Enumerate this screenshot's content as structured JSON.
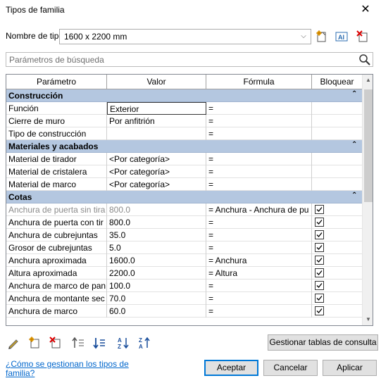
{
  "window": {
    "title": "Tipos de familia",
    "close_glyph": "✕"
  },
  "type": {
    "label": "Nombre de tipo:",
    "value": "1600 x 2200 mm"
  },
  "toolbar_icons": [
    "new-type-icon",
    "rename-type-icon",
    "delete-type-icon"
  ],
  "search": {
    "placeholder": "Parámetros de búsqueda"
  },
  "table": {
    "headers": [
      "Parámetro",
      "Valor",
      "Fórmula",
      "Bloquear"
    ],
    "groups": [
      {
        "label": "Construcción",
        "rows": [
          {
            "param": "Función",
            "value": "Exterior",
            "formula": "=",
            "lock": null
          },
          {
            "param": "Cierre de muro",
            "value": "Por anfitrión",
            "formula": "=",
            "lock": null
          },
          {
            "param": "Tipo de construcción",
            "value": "",
            "formula": "=",
            "lock": null
          }
        ]
      },
      {
        "label": "Materiales y acabados",
        "rows": [
          {
            "param": "Material de tirador",
            "value": "<Por categoría>",
            "formula": "=",
            "lock": null
          },
          {
            "param": "Material de cristalera",
            "value": "<Por categoría>",
            "formula": "=",
            "lock": null
          },
          {
            "param": "Material de marco",
            "value": "<Por categoría>",
            "formula": "=",
            "lock": null
          }
        ]
      },
      {
        "label": "Cotas",
        "rows": [
          {
            "param": "Anchura de puerta sin tira",
            "value": "800.0",
            "formula": "= Anchura - Anchura de pu",
            "lock": true,
            "disabled": true
          },
          {
            "param": "Anchura de puerta con tir",
            "value": "800.0",
            "formula": "=",
            "lock": true
          },
          {
            "param": "Anchura de cubrejuntas",
            "value": "35.0",
            "formula": "=",
            "lock": true
          },
          {
            "param": "Grosor de cubrejuntas",
            "value": "5.0",
            "formula": "=",
            "lock": true
          },
          {
            "param": "Anchura aproximada",
            "value": "1600.0",
            "formula": "= Anchura",
            "lock": true
          },
          {
            "param": "Altura aproximada",
            "value": "2200.0",
            "formula": "= Altura",
            "lock": true
          },
          {
            "param": "Anchura de marco de pan",
            "value": "100.0",
            "formula": "=",
            "lock": true
          },
          {
            "param": "Anchura de montante sec",
            "value": "70.0",
            "formula": "=",
            "lock": true
          },
          {
            "param": "Anchura de marco",
            "value": "60.0",
            "formula": "=",
            "lock": true
          }
        ]
      }
    ]
  },
  "bottom_icons": [
    "edit-pencil-icon",
    "new-parameter-icon",
    "delete-parameter-icon",
    "move-up-icon",
    "move-down-icon",
    "sort-ascending-icon",
    "sort-descending-icon"
  ],
  "buttons": {
    "lookup_tables": "Gestionar tablas de consulta",
    "ok": "Aceptar",
    "cancel": "Cancelar",
    "apply": "Aplicar"
  },
  "help_link": "¿Cómo se gestionan los tipos de familia?",
  "colors": {
    "group_header": "#b4c7e0",
    "accent": "#0078d7",
    "link": "#0066cc"
  }
}
